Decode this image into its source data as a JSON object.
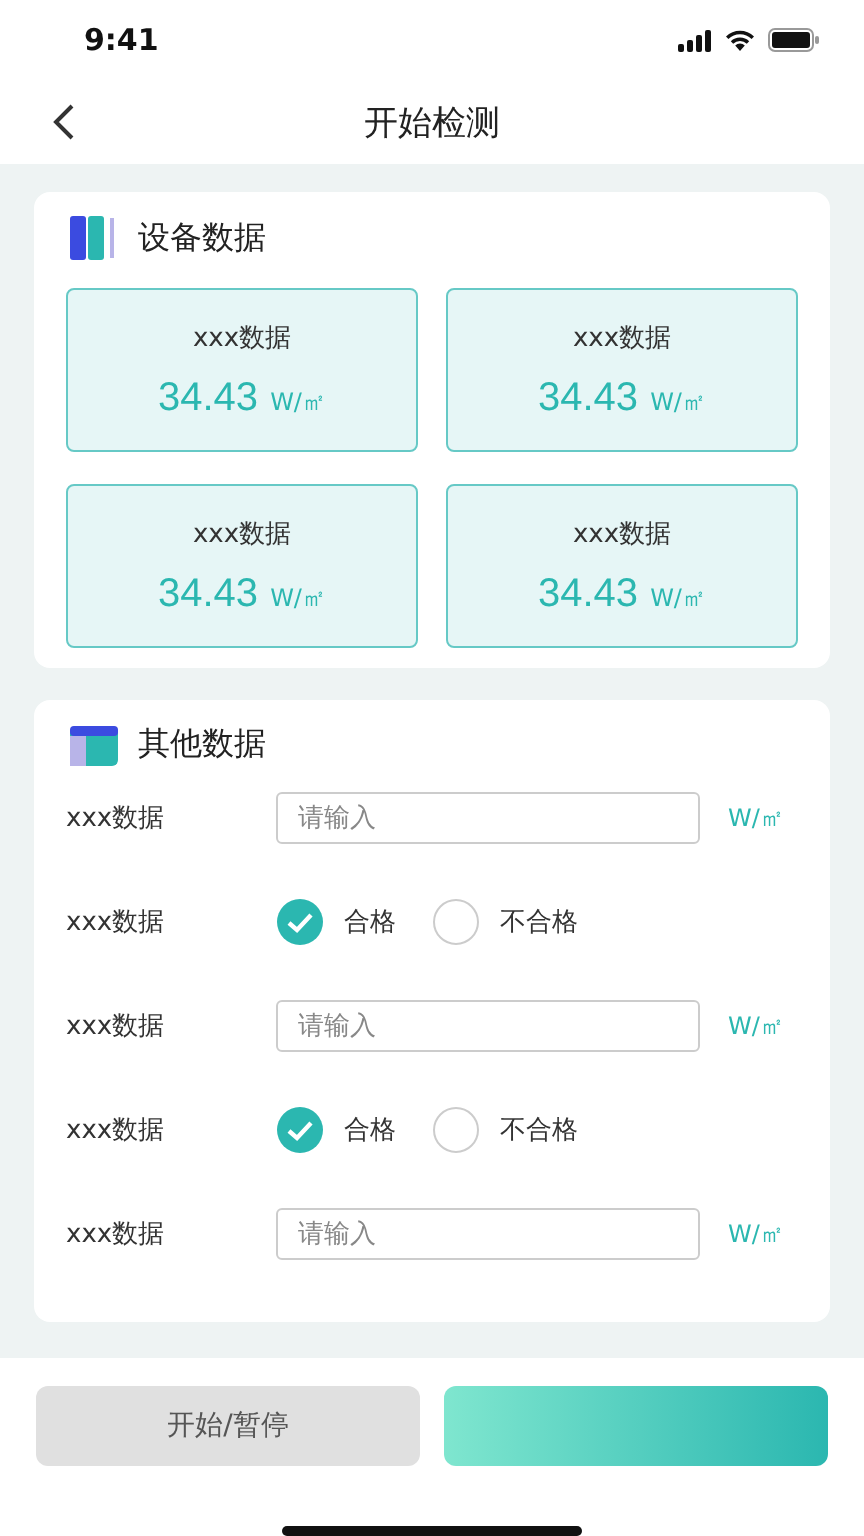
{
  "status_bar": {
    "time": "9:41"
  },
  "header": {
    "title": "开始检测"
  },
  "device_section": {
    "title": "设备数据",
    "tiles": [
      {
        "label": "xxx数据",
        "value": "34.43",
        "unit": "W/㎡"
      },
      {
        "label": "xxx数据",
        "value": "34.43",
        "unit": "W/㎡"
      },
      {
        "label": "xxx数据",
        "value": "34.43",
        "unit": "W/㎡"
      },
      {
        "label": "xxx数据",
        "value": "34.43",
        "unit": "W/㎡"
      }
    ]
  },
  "other_section": {
    "title": "其他数据",
    "rows": [
      {
        "kind": "input",
        "label": "xxx数据",
        "placeholder": "请输入",
        "unit": "W/㎡"
      },
      {
        "kind": "choice",
        "label": "xxx数据",
        "options": [
          {
            "label": "合格",
            "selected": true
          },
          {
            "label": "不合格",
            "selected": false
          }
        ]
      },
      {
        "kind": "input",
        "label": "xxx数据",
        "placeholder": "请输入",
        "unit": "W/㎡"
      },
      {
        "kind": "choice",
        "label": "xxx数据",
        "options": [
          {
            "label": "合格",
            "selected": true
          },
          {
            "label": "不合格",
            "selected": false
          }
        ]
      },
      {
        "kind": "input",
        "label": "xxx数据",
        "placeholder": "请输入",
        "unit": "W/㎡"
      }
    ]
  },
  "buttons": [
    {
      "kind": "secondary",
      "label": "开始/暂停"
    },
    {
      "kind": "primary"
    }
  ]
}
